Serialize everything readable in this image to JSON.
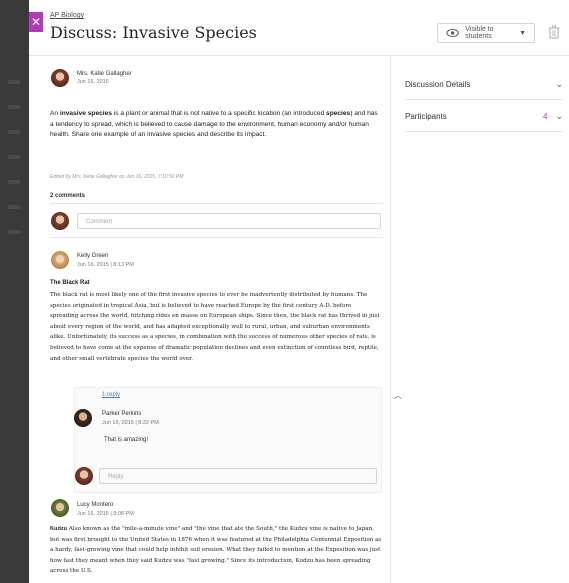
{
  "header": {
    "close_icon": "close-icon",
    "breadcrumb": "AP Biology",
    "title": "Discuss: Invasive Species",
    "visibility_label": "Visible to students",
    "visibility_icon": "eye-icon",
    "trash_icon": "trash-icon"
  },
  "prompt_post": {
    "author": "Mrs. Katie Gallagher",
    "date": "Jun 16, 2015",
    "body_html_parts": [
      "An ",
      "invasive species",
      " is a plant or animal that is not native to a specific location (an introduced ",
      "species",
      ") and has a tendency to spread, which is believed to cause damage to the environment, human economy and/or human health.  Share one example of an invasive species and describe its impact."
    ],
    "edited_note": "Edited by Mrs. Katie Gallagher on Jun 16, 2015, 7:10:50 PM"
  },
  "comments": {
    "count_label": "2 comments",
    "placeholder": "Comment"
  },
  "posts": [
    {
      "author": "Kelly Green",
      "datetime": "Jun 16, 2015  |  8:13 PM",
      "title": "The Black Rat",
      "body": "The black rat is most likely one of the first invasive species to ever be inadvertently distributed by humans. The species originated in tropical Asia, but is believed to have reached Europe by the first century A.D. before spreading across the world, hitching rides en masse on European ships. Since then, the black rat has thrived in just about every region of the world, and has adapted exceptionally well to rural, urban, and suburban environments alike. Unfortunately, its success as a species, in combination with the success of numerous other species of rats, is believed to have come at the expense of dramatic population declines and even extinction of countless bird, reptile, and other small vertebrate species the world over.",
      "reply_link": "1 reply",
      "reply": {
        "author": "Parker Perkins",
        "datetime": "Jun 16, 2015  |  8:32 PM",
        "text": "That is amazing!"
      },
      "reply_placeholder": "Reply"
    },
    {
      "author": "Lucy Montero",
      "datetime": "Jun 16, 2015  |  8:08 PM",
      "title": "Kudzu",
      "body": " Also known as the \"mile-a-minute vine\" and \"the vine that ate the South,\" the Kudzu vine is native to Japan, but was first brought to the United States in 1876 when it was featured at the Philadelphia Centennial Exposition as a hardy, fast-growing vine that could help inhibit soil erosion. What they failed to mention at the Exposition was just how fast they meant when they said Kudzu was \"fast growing.\" Since its introduction, Kudzu has been spreading across the U.S."
    }
  ],
  "sidebar": {
    "details_label": "Discussion Details",
    "participants_label": "Participants",
    "participants_count": "4"
  },
  "colors": {
    "accent": "#b13ab5",
    "link": "#4a7fbf"
  }
}
